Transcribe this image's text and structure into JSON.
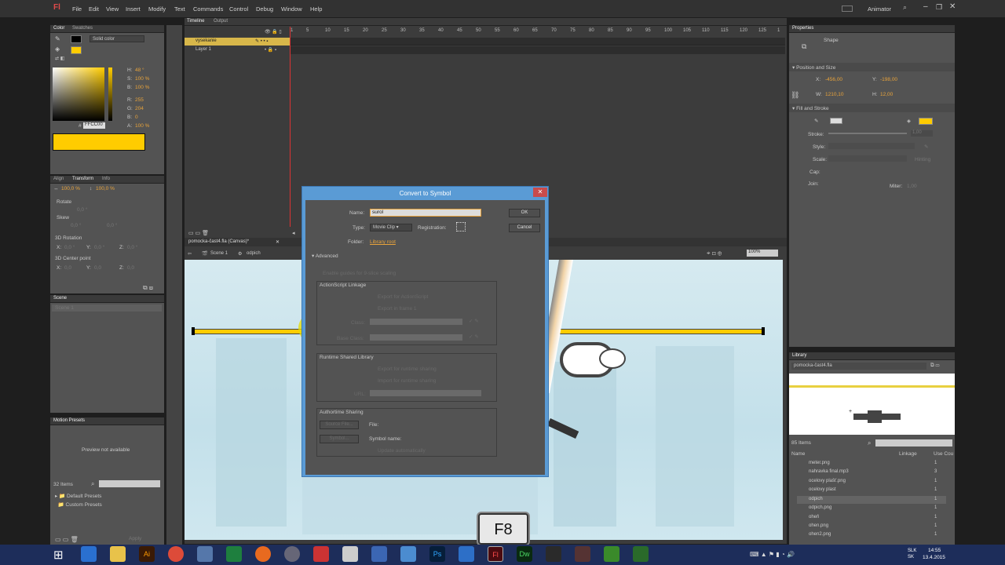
{
  "app": {
    "logo": "Fl",
    "workspace": "Animator"
  },
  "menu": [
    "File",
    "Edit",
    "View",
    "Insert",
    "Modify",
    "Text",
    "Commands",
    "Control",
    "Debug",
    "Window",
    "Help"
  ],
  "color_panel": {
    "tabs": [
      "Color",
      "Swatches"
    ],
    "mode": "Solid color",
    "h": "48 °",
    "s": "100 %",
    "b": "100 %",
    "r": "255",
    "g": "204",
    "bl": "0",
    "a": "100 %",
    "hex": "FFCC00",
    "hex_prefix": "#",
    "labels": {
      "h": "H:",
      "s": "S:",
      "b": "B:",
      "r": "R:",
      "g": "G:",
      "bl": "B:",
      "a": "A:"
    },
    "fill_color": "#FFCC00"
  },
  "transform_panel": {
    "tabs": [
      "Align",
      "Transform",
      "Info"
    ],
    "width_pct": "100,0 %",
    "height_pct": "100,0 %",
    "rotate": "Rotate",
    "rotate_val": "0,0 °",
    "skew": "Skew",
    "skew_a": "0,0 °",
    "skew_b": "0,0 °",
    "rot3d": "3D Rotation",
    "center3d": "3D Center point",
    "x_lbl": "X:",
    "y_lbl": "Y:",
    "z_lbl": "Z:",
    "rx": "0,0 °",
    "ry": "0,0 °",
    "rz": "0,0 °",
    "cx": "0,0",
    "cy": "0,0",
    "cz": "0,0"
  },
  "scene_panel": {
    "tab": "Scene",
    "item": "Scene 1"
  },
  "motion_presets": {
    "tab": "Motion Presets",
    "preview": "Preview not available",
    "count": "32 Items",
    "folders": [
      "Default Presets",
      "Custom Presets"
    ],
    "apply": "Apply"
  },
  "timeline": {
    "tabs": [
      "Timeline",
      "Output"
    ],
    "layers": [
      "vysekanie",
      "Layer 1"
    ],
    "frames": [
      "1",
      "5",
      "10",
      "15",
      "20",
      "25",
      "30",
      "35",
      "40",
      "45",
      "50",
      "55",
      "60",
      "65",
      "70",
      "75",
      "80",
      "85",
      "90",
      "95",
      "100",
      "105",
      "110",
      "115",
      "120",
      "125",
      "1"
    ]
  },
  "document": {
    "tab": "pomocka-čast4.fla (Canvas)*",
    "scene": "Scene 1",
    "symbol": "odpich",
    "zoom": "100%"
  },
  "dialog": {
    "title": "Convert to Symbol",
    "name_lbl": "Name:",
    "name_val": "surol",
    "type_lbl": "Type:",
    "type_val": "Movie Clip",
    "reg_lbl": "Registration:",
    "folder_lbl": "Folder:",
    "folder_val": "Library root",
    "ok": "OK",
    "cancel": "Cancel",
    "advanced": "Advanced",
    "guides": "Enable guides for 9-slice scaling",
    "as_link": "ActionScript Linkage",
    "export_as": "Export for ActionScript",
    "export_frame": "Export in frame 1",
    "class_lbl": "Class:",
    "base_lbl": "Base Class:",
    "rsl": "Runtime Shared Library",
    "export_rs": "Export for runtime sharing",
    "import_rs": "Import for runtime sharing",
    "url_lbl": "URL:",
    "authortime": "Authortime Sharing",
    "source_btn": "Source File...",
    "file_lbl": "File:",
    "symbol_btn": "Symbol...",
    "symname_lbl": "Symbol name:",
    "update_auto": "Update automatically"
  },
  "properties": {
    "tab": "Properties",
    "shape": "Shape",
    "pos_size": "Position and Size",
    "x_lbl": "X:",
    "x": "-456,00",
    "y_lbl": "Y:",
    "y": "-198,00",
    "w_lbl": "W:",
    "w": "1210,10",
    "h_lbl": "H:",
    "h": "12,00",
    "fill_stroke": "Fill and Stroke",
    "stroke": "Stroke:",
    "stroke_val": "1,00",
    "style": "Style:",
    "scale": "Scale:",
    "hinting": "Hinting",
    "cap": "Cap:",
    "join": "Join:",
    "miter": "Miter:",
    "miter_val": "1,00",
    "fill_color": "#FFCC00"
  },
  "library": {
    "tab": "Library",
    "file": "pomocka-čast4.fla",
    "count": "85 Items",
    "col_name": "Name",
    "col_link": "Linkage",
    "col_use": "Use Cou",
    "items": [
      {
        "name": "meter.png",
        "count": "1"
      },
      {
        "name": "nahravka final.mp3",
        "count": "3"
      },
      {
        "name": "ocelovy plašť.png",
        "count": "1"
      },
      {
        "name": "ocelovy plast",
        "count": "1"
      },
      {
        "name": "odpich",
        "count": "1"
      },
      {
        "name": "odpich.png",
        "count": "1"
      },
      {
        "name": "oheň",
        "count": "1"
      },
      {
        "name": "ohen.png",
        "count": "1"
      },
      {
        "name": "ohen2.png",
        "count": "1"
      }
    ]
  },
  "key_overlay": "F8",
  "taskbar": {
    "lang": "SLK\nSK",
    "time": "14:55",
    "date": "13.4.2015",
    "apps": [
      "Ai",
      "Ps",
      "Fl",
      "Dw"
    ]
  }
}
